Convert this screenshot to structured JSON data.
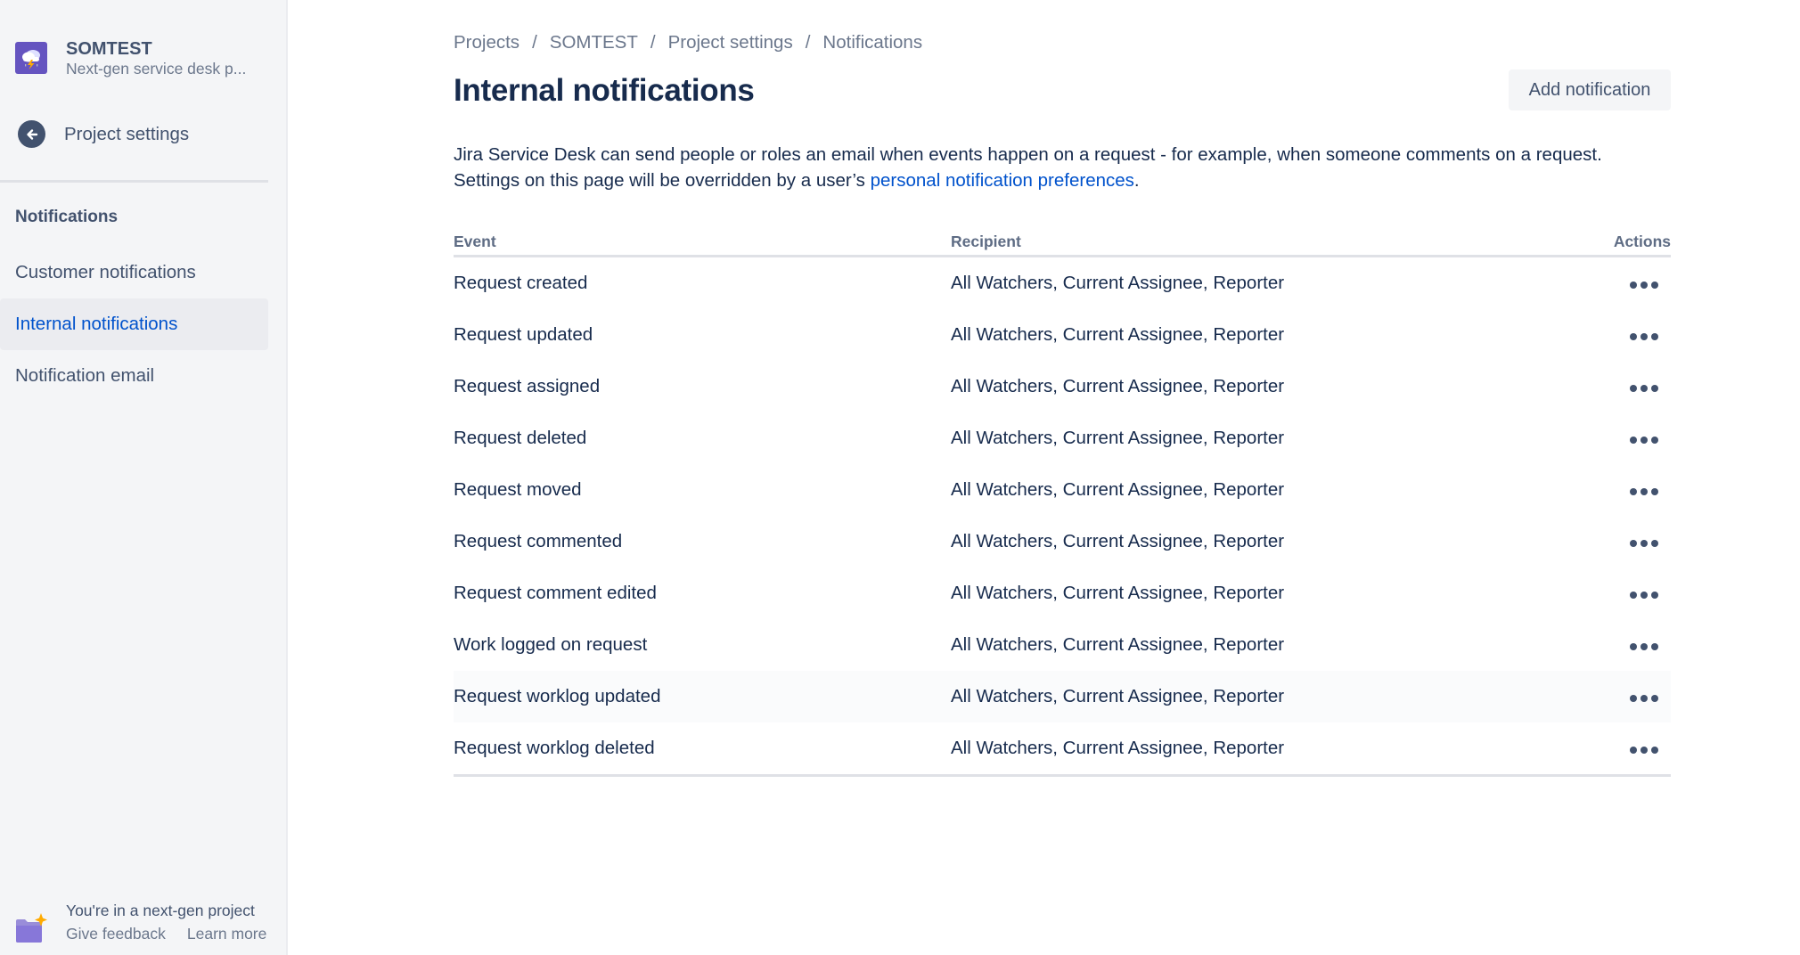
{
  "sidebar": {
    "project_name": "SOMTEST",
    "project_type": "Next-gen service desk p...",
    "back_label": "Project settings",
    "section_title": "Notifications",
    "items": [
      {
        "label": "Customer notifications",
        "selected": false
      },
      {
        "label": "Internal notifications",
        "selected": true
      },
      {
        "label": "Notification email",
        "selected": false
      }
    ],
    "footer": {
      "title": "You're in a next-gen project",
      "give_feedback": "Give feedback",
      "learn_more": "Learn more"
    }
  },
  "breadcrumb": [
    "Projects",
    "SOMTEST",
    "Project settings",
    "Notifications"
  ],
  "breadcrumb_separator": "/",
  "page_title": "Internal notifications",
  "add_button_label": "Add notification",
  "description": {
    "line1": "Jira Service Desk can send people or roles an email when events happen on a request - for example, when someone comments on a request.",
    "line2_prefix": "Settings on this page will be overridden by a user’s ",
    "link_text": "personal notification preferences",
    "line2_suffix": "."
  },
  "table": {
    "headers": {
      "event": "Event",
      "recipient": "Recipient",
      "actions": "Actions"
    },
    "rows": [
      {
        "event": "Request created",
        "recipient": "All Watchers, Current Assignee, Reporter"
      },
      {
        "event": "Request updated",
        "recipient": "All Watchers, Current Assignee, Reporter"
      },
      {
        "event": "Request assigned",
        "recipient": "All Watchers, Current Assignee, Reporter"
      },
      {
        "event": "Request deleted",
        "recipient": "All Watchers, Current Assignee, Reporter"
      },
      {
        "event": "Request moved",
        "recipient": "All Watchers, Current Assignee, Reporter"
      },
      {
        "event": "Request commented",
        "recipient": "All Watchers, Current Assignee, Reporter"
      },
      {
        "event": "Request comment edited",
        "recipient": "All Watchers, Current Assignee, Reporter"
      },
      {
        "event": "Work logged on request",
        "recipient": "All Watchers, Current Assignee, Reporter"
      },
      {
        "event": "Request worklog updated",
        "recipient": "All Watchers, Current Assignee, Reporter",
        "hovered": true
      },
      {
        "event": "Request worklog deleted",
        "recipient": "All Watchers, Current Assignee, Reporter"
      }
    ]
  },
  "icons": {
    "project_avatar": "storm-cloud-icon",
    "back": "arrow-left-circle-icon",
    "footer": "folder-sparkle-icon",
    "row_actions": "more-horizontal-icon"
  },
  "colors": {
    "sidebar_bg": "#f4f5f7",
    "selected_bg": "#ebecf0",
    "link": "#0052cc",
    "text": "#172b4d",
    "subtle_text": "#6b778c",
    "avatar_bg": "#6554c0"
  }
}
